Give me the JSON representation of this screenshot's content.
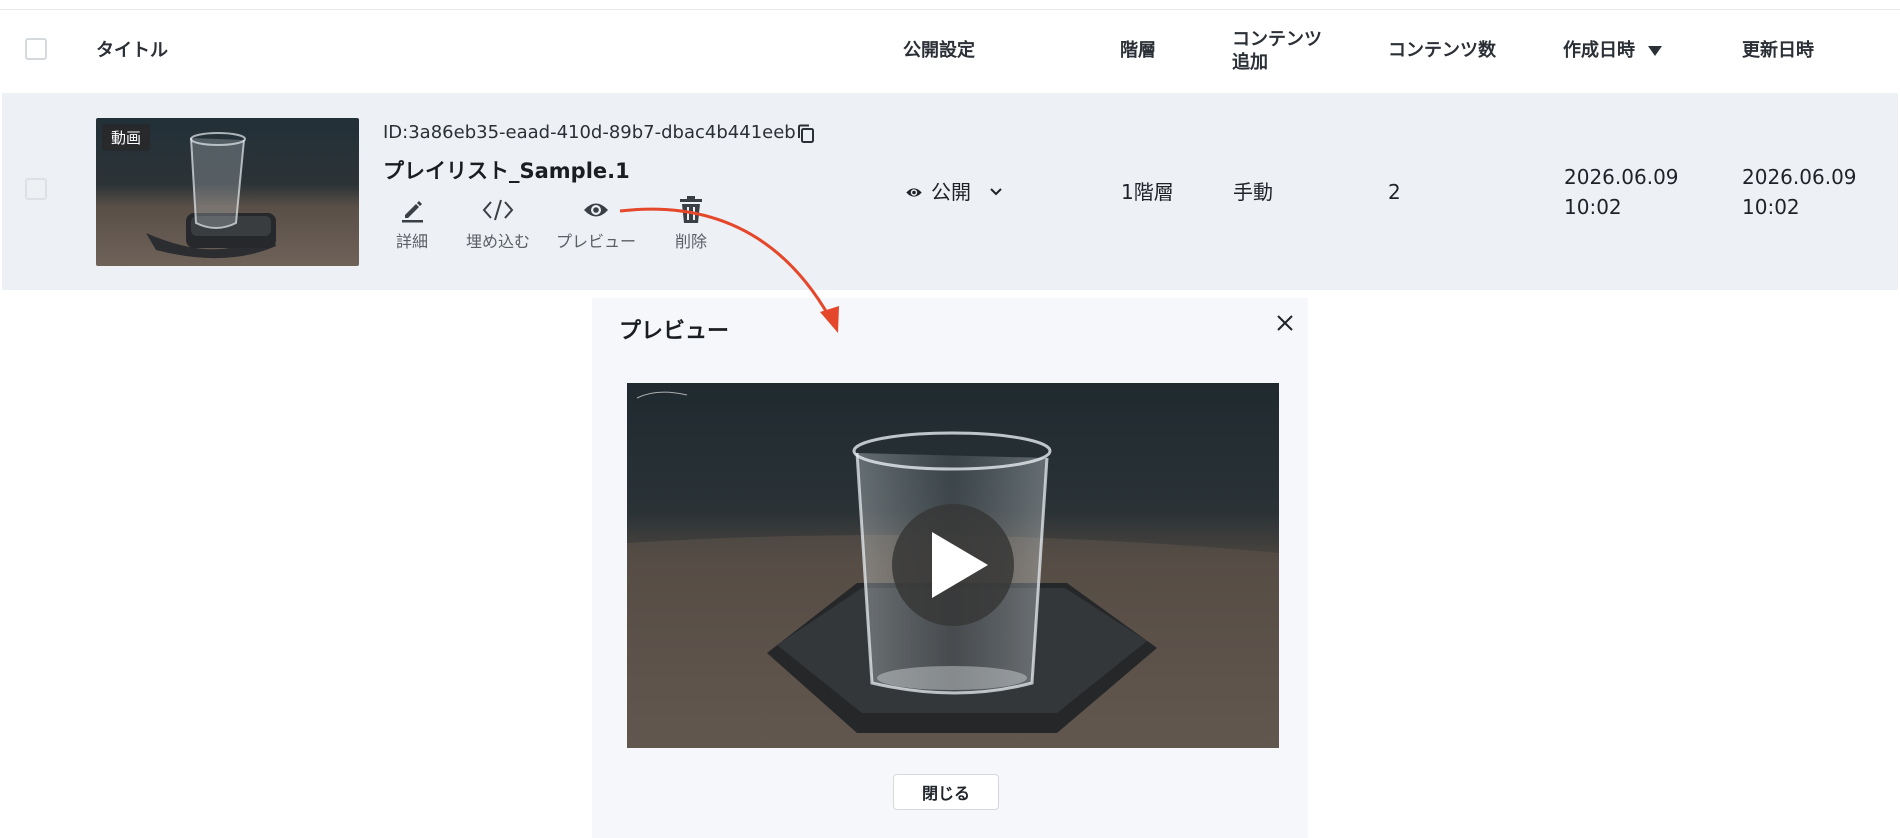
{
  "header": {
    "title_label": "タイトル",
    "visibility_label": "公開設定",
    "hierarchy_label": "階層",
    "content_add_label_line1": "コンテンツ",
    "content_add_label_line2": "追加",
    "content_count_label": "コンテンツ数",
    "created_label": "作成日時",
    "updated_label": "更新日時",
    "sort_icon": "caret-down-icon"
  },
  "row": {
    "badge": "動画",
    "id_text": "ID:3a86eb35-eaad-410d-89b7-dbac4b441eeb",
    "title": "プレイリスト_Sample.1",
    "actions": [
      {
        "label": "詳細",
        "icon": "pencil-icon"
      },
      {
        "label": "埋め込む",
        "icon": "code-icon"
      },
      {
        "label": "プレビュー",
        "icon": "eye-icon"
      },
      {
        "label": "削除",
        "icon": "trash-icon"
      }
    ],
    "visibility": "公開",
    "hierarchy": "1階層",
    "content_add": "手動",
    "content_count": "2",
    "created_date": "2026.06.09",
    "created_time": "10:02",
    "updated_date": "2026.06.09",
    "updated_time": "10:02"
  },
  "modal": {
    "title": "プレビュー",
    "close_button": "閉じる"
  },
  "colors": {
    "row_bg": "#edf0f4",
    "modal_bg": "#f5f7fa",
    "annotation_arrow": "#e5472b"
  }
}
